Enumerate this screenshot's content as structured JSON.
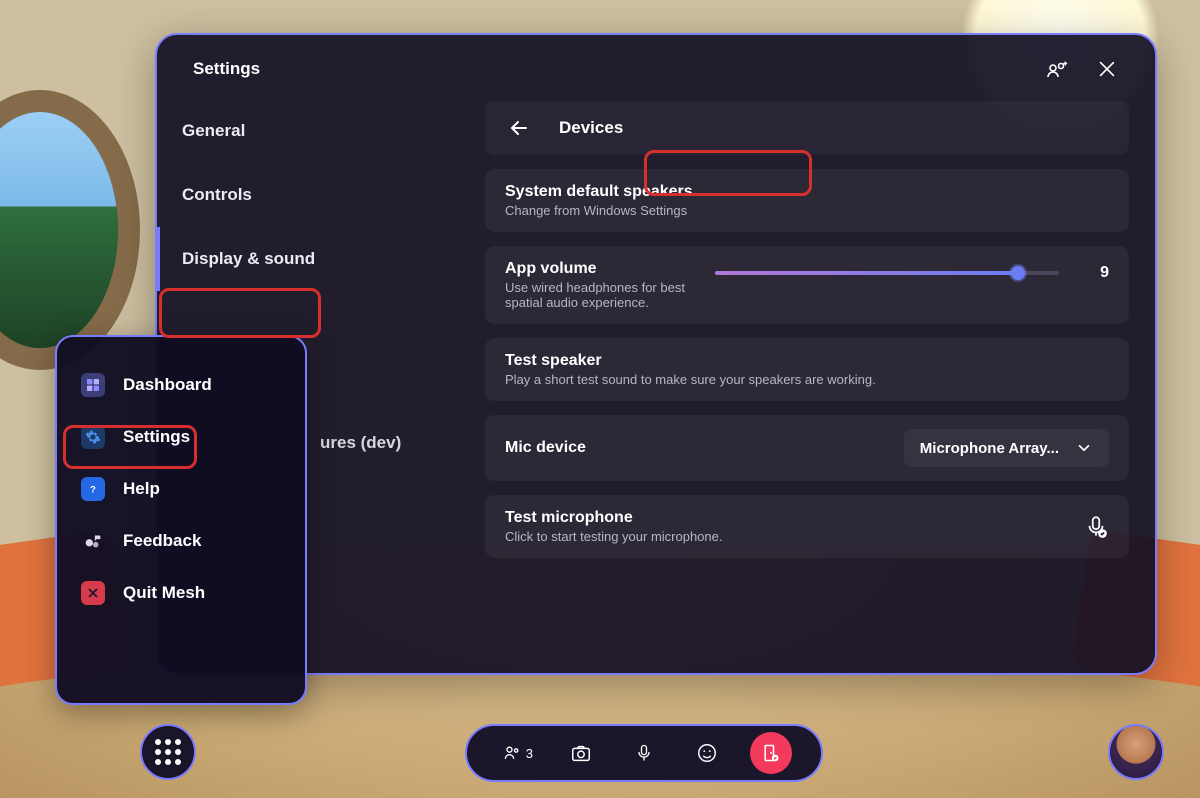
{
  "header": {
    "title": "Settings"
  },
  "sidebar": {
    "items": [
      {
        "label": "General"
      },
      {
        "label": "Controls"
      },
      {
        "label": "Display & sound"
      },
      {
        "label": "ures (dev)"
      }
    ]
  },
  "content": {
    "back_title": "Devices",
    "speakers": {
      "title": "System default speakers",
      "sub": "Change from Windows Settings"
    },
    "volume": {
      "title": "App volume",
      "sub": "Use wired headphones for best spatial audio experience.",
      "value": "9",
      "percent": 88
    },
    "test_speaker": {
      "title": "Test speaker",
      "sub": "Play a short test sound to make sure your speakers are working."
    },
    "mic_device": {
      "title": "Mic device",
      "selected": "Microphone Array..."
    },
    "test_mic": {
      "title": "Test microphone",
      "sub": "Click to start testing your microphone."
    }
  },
  "menu": {
    "items": [
      {
        "label": "Dashboard"
      },
      {
        "label": "Settings"
      },
      {
        "label": "Help"
      },
      {
        "label": "Feedback"
      },
      {
        "label": "Quit Mesh"
      }
    ]
  },
  "toolbar": {
    "people_count": "3"
  }
}
